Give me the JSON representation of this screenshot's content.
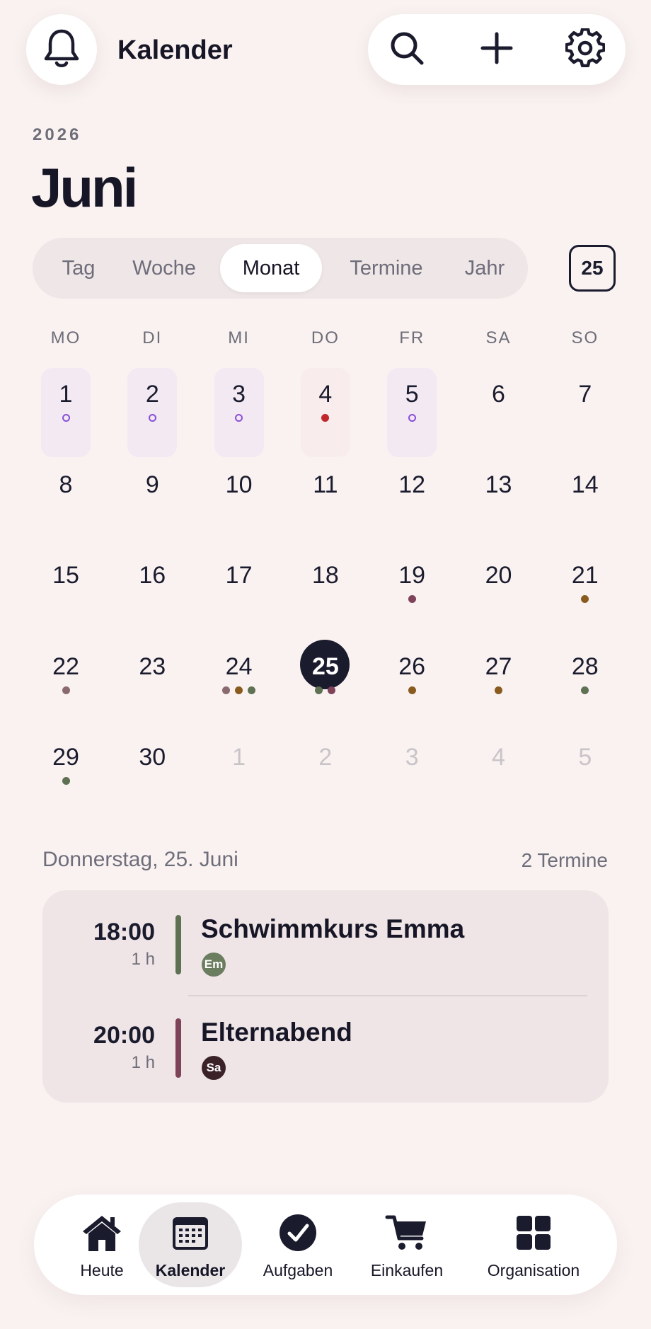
{
  "header": {
    "title": "Kalender",
    "icons": [
      "bell-icon",
      "search-icon",
      "plus-icon",
      "gear-icon"
    ]
  },
  "calendar": {
    "year": "2026",
    "month": "Juni",
    "today_button": "25",
    "views": [
      {
        "label": "Tag",
        "active": false
      },
      {
        "label": "Woche",
        "active": false
      },
      {
        "label": "Monat",
        "active": true
      },
      {
        "label": "Termine",
        "active": false
      },
      {
        "label": "Jahr",
        "active": false
      }
    ],
    "weekdays": [
      "MO",
      "DI",
      "MI",
      "DO",
      "FR",
      "SA",
      "SO"
    ],
    "weeks": [
      [
        {
          "d": "1",
          "hl": "purple",
          "dots": [
            "ring"
          ]
        },
        {
          "d": "2",
          "hl": "purple",
          "dots": [
            "ring"
          ]
        },
        {
          "d": "3",
          "hl": "purple",
          "dots": [
            "ring"
          ]
        },
        {
          "d": "4",
          "hl": "red",
          "dots": [
            "red"
          ]
        },
        {
          "d": "5",
          "hl": "purple",
          "dots": [
            "ring"
          ]
        },
        {
          "d": "6",
          "dots": []
        },
        {
          "d": "7",
          "dots": []
        }
      ],
      [
        {
          "d": "8",
          "dots": []
        },
        {
          "d": "9",
          "dots": []
        },
        {
          "d": "10",
          "dots": []
        },
        {
          "d": "11",
          "dots": []
        },
        {
          "d": "12",
          "dots": []
        },
        {
          "d": "13",
          "dots": []
        },
        {
          "d": "14",
          "dots": []
        }
      ],
      [
        {
          "d": "15",
          "dots": []
        },
        {
          "d": "16",
          "dots": []
        },
        {
          "d": "17",
          "dots": []
        },
        {
          "d": "18",
          "dots": []
        },
        {
          "d": "19",
          "dots": [
            "plum"
          ]
        },
        {
          "d": "20",
          "dots": []
        },
        {
          "d": "21",
          "dots": [
            "brown"
          ]
        }
      ],
      [
        {
          "d": "22",
          "dots": [
            "mauve"
          ]
        },
        {
          "d": "23",
          "dots": []
        },
        {
          "d": "24",
          "dots": [
            "mauve",
            "brown",
            "green"
          ]
        },
        {
          "d": "25",
          "selected": true,
          "dots": [
            "green",
            "plum"
          ]
        },
        {
          "d": "26",
          "dots": [
            "brown"
          ]
        },
        {
          "d": "27",
          "dots": [
            "brown"
          ]
        },
        {
          "d": "28",
          "dots": [
            "green"
          ]
        }
      ],
      [
        {
          "d": "29",
          "dots": [
            "green"
          ]
        },
        {
          "d": "30",
          "dots": []
        },
        {
          "d": "1",
          "other": true,
          "dots": []
        },
        {
          "d": "2",
          "other": true,
          "dots": []
        },
        {
          "d": "3",
          "other": true,
          "dots": []
        },
        {
          "d": "4",
          "other": true,
          "dots": []
        },
        {
          "d": "5",
          "other": true,
          "dots": []
        }
      ]
    ]
  },
  "dot_colors": {
    "ring": "#8a4fd8",
    "red": "#c0262b",
    "plum": "#7e4259",
    "brown": "#8a5b1f",
    "mauve": "#8a6a6e",
    "green": "#5e7153"
  },
  "agenda": {
    "date_label": "Donnerstag, 25. Juni",
    "count_label": "2 Termine",
    "events": [
      {
        "time": "18:00",
        "duration": "1 h",
        "title": "Schwimmkurs Emma",
        "avatar": "Em",
        "color": "#5e7153"
      },
      {
        "time": "20:00",
        "duration": "1 h",
        "title": "Elternabend",
        "avatar": "Sa",
        "color": "#7e4259",
        "avatar_color": "#3b2228"
      }
    ]
  },
  "tabbar": {
    "items": [
      {
        "label": "Heute",
        "icon": "home-icon",
        "active": false
      },
      {
        "label": "Kalender",
        "icon": "calendar-icon",
        "active": true
      },
      {
        "label": "Aufgaben",
        "icon": "check-circle-icon",
        "active": false
      },
      {
        "label": "Einkaufen",
        "icon": "cart-icon",
        "active": false
      },
      {
        "label": "Organisation",
        "icon": "grid-icon",
        "active": false
      }
    ]
  }
}
